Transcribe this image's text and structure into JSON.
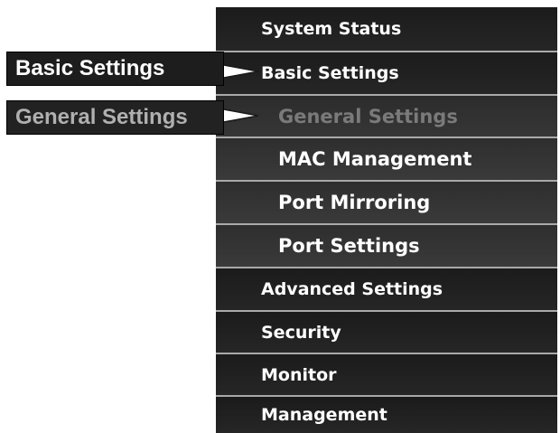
{
  "menu": {
    "items": [
      {
        "label": "System Status",
        "level": "top",
        "active": false
      },
      {
        "label": "Basic Settings",
        "level": "top",
        "active": false
      },
      {
        "label": "General Settings",
        "level": "sub",
        "active": true
      },
      {
        "label": "MAC Management",
        "level": "sub",
        "active": false
      },
      {
        "label": "Port Mirroring",
        "level": "sub",
        "active": false
      },
      {
        "label": "Port Settings",
        "level": "sub",
        "active": false
      },
      {
        "label": "Advanced Settings",
        "level": "top",
        "active": false
      },
      {
        "label": "Security",
        "level": "top",
        "active": false
      },
      {
        "label": "Monitor",
        "level": "top",
        "active": false
      },
      {
        "label": "Management",
        "level": "top",
        "active": false
      }
    ]
  },
  "callouts": {
    "basic": {
      "label": "Basic Settings"
    },
    "general": {
      "label": "General Settings"
    }
  },
  "colors": {
    "menu_background": "#1f1f1f",
    "submenu_background": "#343434",
    "divider": "#a9a9a9",
    "active_text": "#7a7a7a",
    "text": "#ffffff"
  }
}
